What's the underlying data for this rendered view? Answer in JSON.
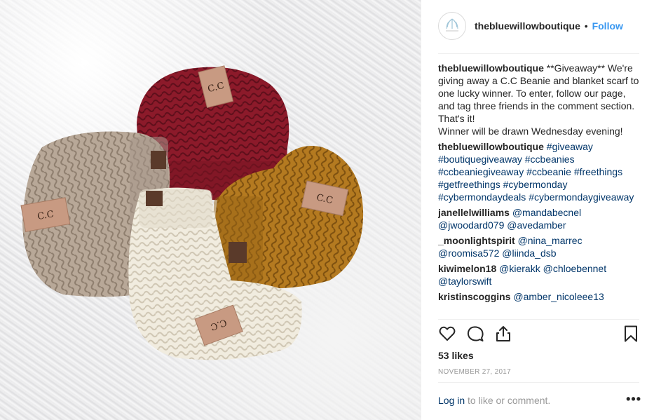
{
  "post": {
    "username": "thebluewillowboutique",
    "separator": "•",
    "follow_label": "Follow",
    "caption": {
      "username": "thebluewillowboutique",
      "text": "**Giveaway** We're giving away a C.C Beanie and blanket scarf to one lucky winner. To enter, follow our page, and tag three friends in the comment section. That's it!\nWinner will be drawn Wednesday evening!"
    },
    "hashtag_comment": {
      "username": "thebluewillowboutique",
      "tags": [
        "#giveaway",
        "#boutiquegiveaway",
        "#ccbeanies",
        "#ccbeaniegiveaway",
        "#ccbeanie",
        "#freethings",
        "#getfreethings",
        "#cybermonday",
        "#cybermondaydeals",
        "#cybermondaygiveaway"
      ]
    },
    "comments": [
      {
        "username": "janellelwilliams",
        "mentions": [
          "@mandabecnel",
          "@jwoodard079",
          "@avedamber"
        ]
      },
      {
        "username": "_moonlightspirit",
        "mentions": [
          "@nina_marrec",
          "@roomisa572",
          "@liinda_dsb"
        ]
      },
      {
        "username": "kiwimelon18",
        "mentions": [
          "@kierakk",
          "@chloebennet",
          "@taylorswift"
        ]
      },
      {
        "username": "kristinscoggins",
        "mentions": [
          "@amber_nicoleee13"
        ]
      }
    ],
    "likes": "53 likes",
    "date": "NOVEMBER 27, 2017",
    "footer": {
      "login_label": "Log in",
      "rest_text": "to like or comment.",
      "more_label": "•••"
    },
    "icons": {
      "like": "heart-icon",
      "comment": "comment-icon",
      "share": "share-icon",
      "save": "bookmark-icon",
      "more": "more-icon"
    },
    "photo": {
      "tag_text": "C.C"
    }
  },
  "colors": {
    "follow": "#3897f0",
    "link": "#003569",
    "muted": "#999999",
    "text": "#262626",
    "beanie_red": "#8c1a2a",
    "beanie_taupe": "#b8a898",
    "beanie_mustard": "#b47a20",
    "beanie_cream": "#f1ecdf"
  }
}
